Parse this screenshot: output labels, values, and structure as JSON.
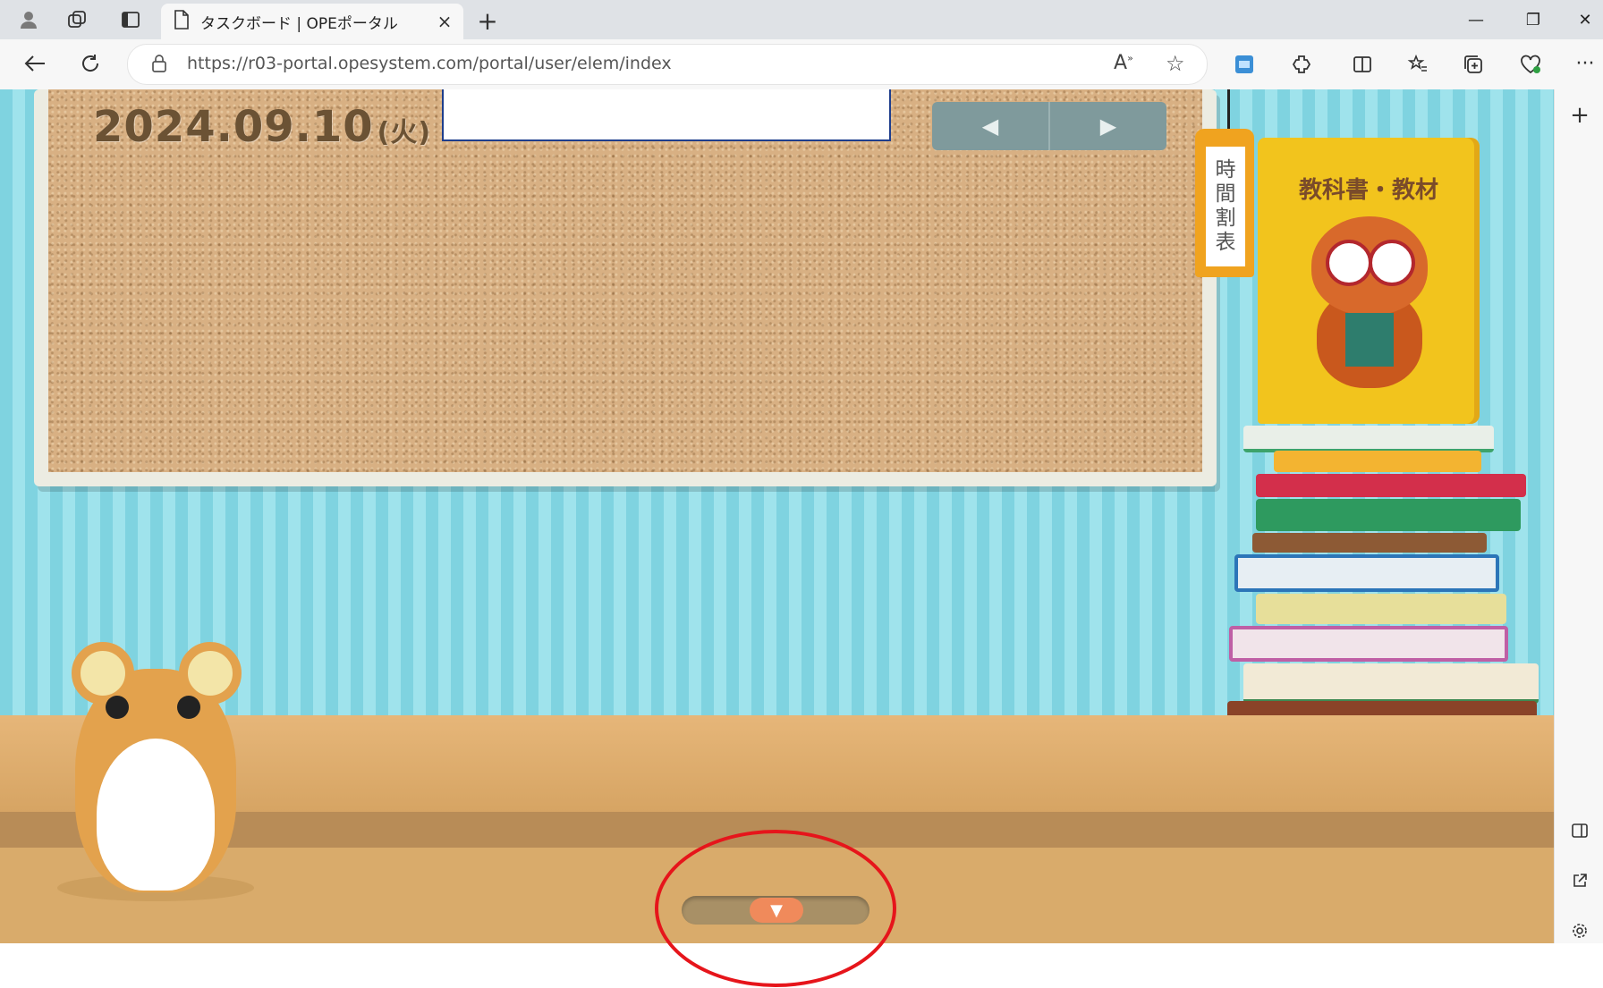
{
  "browser": {
    "tab_title": "タスクボード | OPEポータル",
    "url": "https://r03-portal.opesystem.com/portal/user/elem/index",
    "tab_close": "×",
    "new_tab": "+",
    "window": {
      "minimize": "—",
      "restore": "❐",
      "close": "✕"
    },
    "more": "···",
    "sidebar_add": "+"
  },
  "board": {
    "date": "2024.09.10",
    "weekday": "(火)",
    "prev_arrow": "◀",
    "next_arrow": "▶"
  },
  "timetable": {
    "chars": [
      "時",
      "間",
      "割",
      "表"
    ]
  },
  "textbook": {
    "title": "教科書・教材"
  },
  "drawer": {
    "toggle": "▼"
  },
  "colors": {
    "highlight": "#e6151b",
    "corkboard": "#d8b083",
    "wall": "#7fd3e0"
  }
}
